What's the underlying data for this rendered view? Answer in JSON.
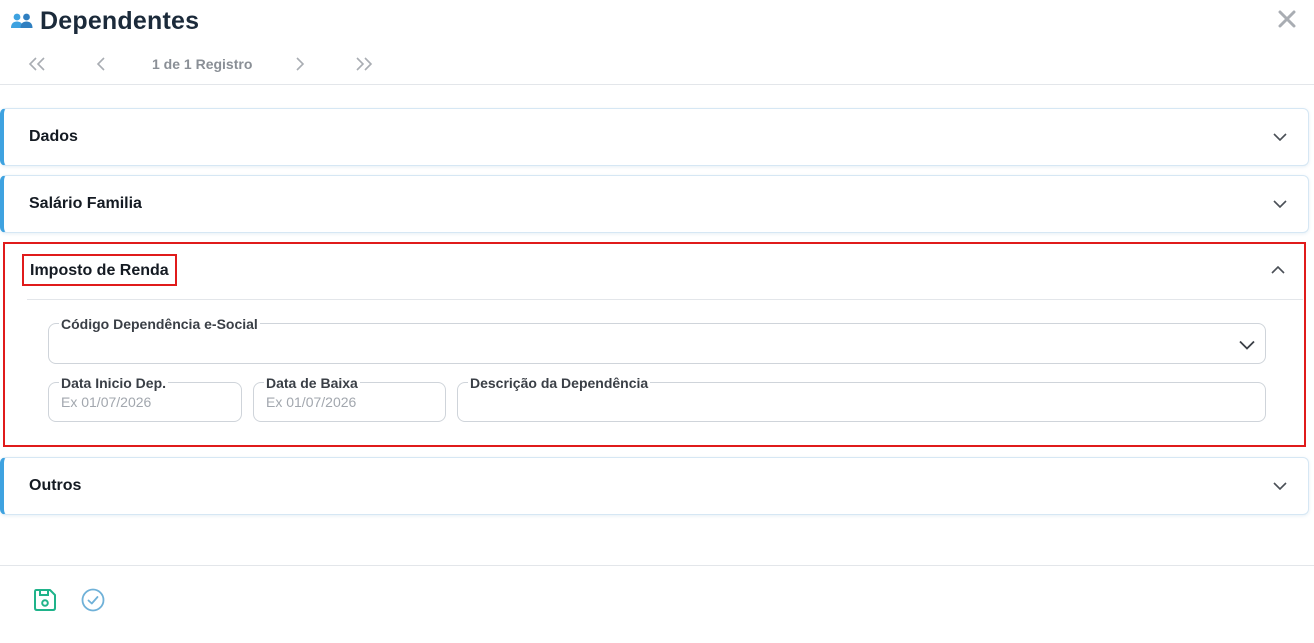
{
  "window": {
    "title": "Dependentes",
    "title_icon": "users-icon",
    "close_icon": "close-icon"
  },
  "pager": {
    "info": "1 de 1 Registro",
    "first_icon": "chevrons-left-icon",
    "prev_icon": "chevron-left-icon",
    "next_icon": "chevron-right-icon",
    "last_icon": "chevrons-right-icon"
  },
  "sections": {
    "dados": {
      "label": "Dados",
      "state": "collapsed"
    },
    "salario": {
      "label": "Salário Familia",
      "state": "collapsed"
    },
    "imposto": {
      "label": "Imposto de Renda",
      "state": "expanded"
    },
    "outros": {
      "label": "Outros",
      "state": "collapsed"
    }
  },
  "imposto_form": {
    "codigo": {
      "label": "Código Dependência e-Social",
      "value": ""
    },
    "data_inicio": {
      "label": "Data Inicio Dep.",
      "placeholder": "Ex 01/07/2026",
      "value": ""
    },
    "data_baixa": {
      "label": "Data de Baixa",
      "placeholder": "Ex 01/07/2026",
      "value": ""
    },
    "descricao": {
      "label": "Descrição da Dependência",
      "value": ""
    }
  },
  "footer": {
    "save_icon": "save-icon",
    "confirm_icon": "check-circle-icon"
  },
  "colors": {
    "accent": "#3ea2e0",
    "highlight": "#e01b1b",
    "save": "#1fb38a",
    "confirm": "#6fb1d8"
  }
}
